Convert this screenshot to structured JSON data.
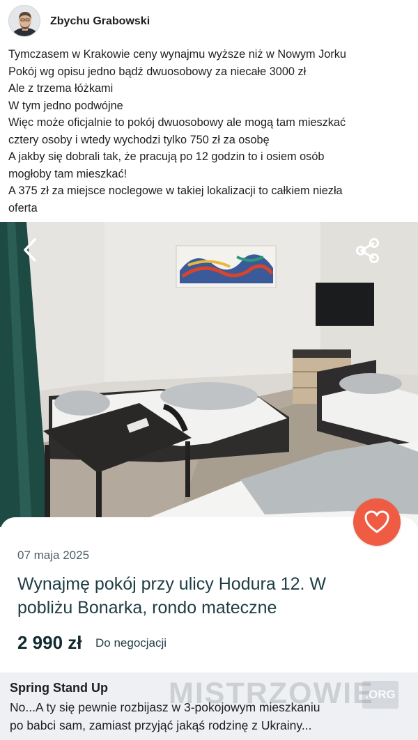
{
  "post": {
    "author": "Zbychu Grabowski",
    "lines": [
      "Tymczasem w Krakowie ceny wynajmu wyższe niż w Nowym Jorku",
      "Pokój wg opisu jedno bądź dwuosobowy za niecałe 3000 zł",
      "Ale z trzema łóżkami",
      "W tym jedno podwójne",
      "Więc może oficjalnie to pokój dwuosobowy ale mogą tam mieszkać",
      "cztery osoby i wtedy wychodzi tylko 750 zł za osobę",
      "A jakby się dobrali tak, że pracują po 12 godzin to i osiem osób",
      "mogłoby tam mieszkać!",
      "A 375 zł za miejsce noclegowe w takiej lokalizacji to całkiem niezła",
      "oferta"
    ]
  },
  "listing": {
    "date": "07 maja 2025",
    "title_line1": "Wynajmę pokój przy ulicy Hodura 12. W",
    "title_line2": "pobliżu Bonarka, rondo mateczne",
    "price": "2 990 zł",
    "negotiable": "Do negocjacji",
    "icons": {
      "back": "chevron-left-icon",
      "share": "share-icon",
      "favorite": "heart-icon"
    },
    "colors": {
      "favorite_button": "#f05b43",
      "title": "#1f3c44",
      "date": "#506168"
    }
  },
  "comment": {
    "author": "Spring Stand Up",
    "line1": "No...A ty się pewnie rozbijasz w 3-pokojowym mieszkaniu",
    "line2": "po babci sam, zamiast przyjąć jakąś rodzinę z Ukrainy..."
  },
  "watermark": {
    "text": "MISTRZOWIE",
    "suffix": ".ORG"
  }
}
